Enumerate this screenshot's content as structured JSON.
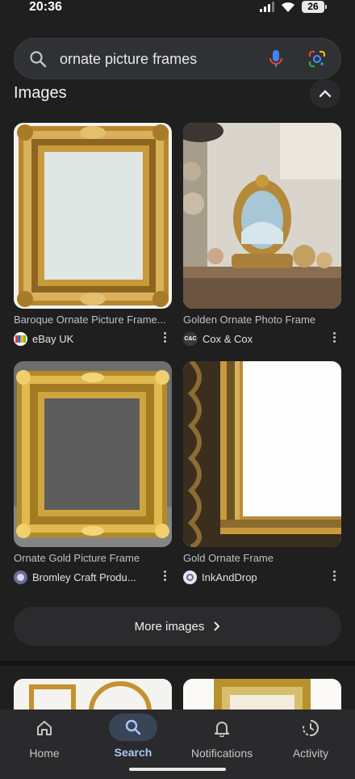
{
  "status_bar": {
    "time": "20:36",
    "battery": "26"
  },
  "search": {
    "query": "ornate picture frames"
  },
  "images_section": {
    "heading": "Images",
    "results": [
      {
        "title": "Baroque Ornate Picture Frame...",
        "source": "eBay UK",
        "favicon": "ebay-icon"
      },
      {
        "title": "Golden Ornate Photo Frame",
        "source": "Cox & Cox",
        "favicon_text": "C&C"
      },
      {
        "title": "Ornate Gold Picture Frame",
        "source": "Bromley Craft Produ...",
        "favicon": "bromley-icon"
      },
      {
        "title": "Gold Ornate Frame",
        "source": "InkAndDrop",
        "favicon": "inkanddrop-icon"
      }
    ],
    "more_label": "More images"
  },
  "bottom_nav": {
    "items": [
      {
        "label": "Home",
        "icon": "home-icon"
      },
      {
        "label": "Search",
        "icon": "search-icon",
        "active": true
      },
      {
        "label": "Notifications",
        "icon": "bell-icon"
      },
      {
        "label": "Activity",
        "icon": "activity-icon"
      }
    ]
  },
  "colors": {
    "background": "#1f1f1f",
    "active_nav": "#a8c7fa",
    "gold": "#c9a13b"
  }
}
